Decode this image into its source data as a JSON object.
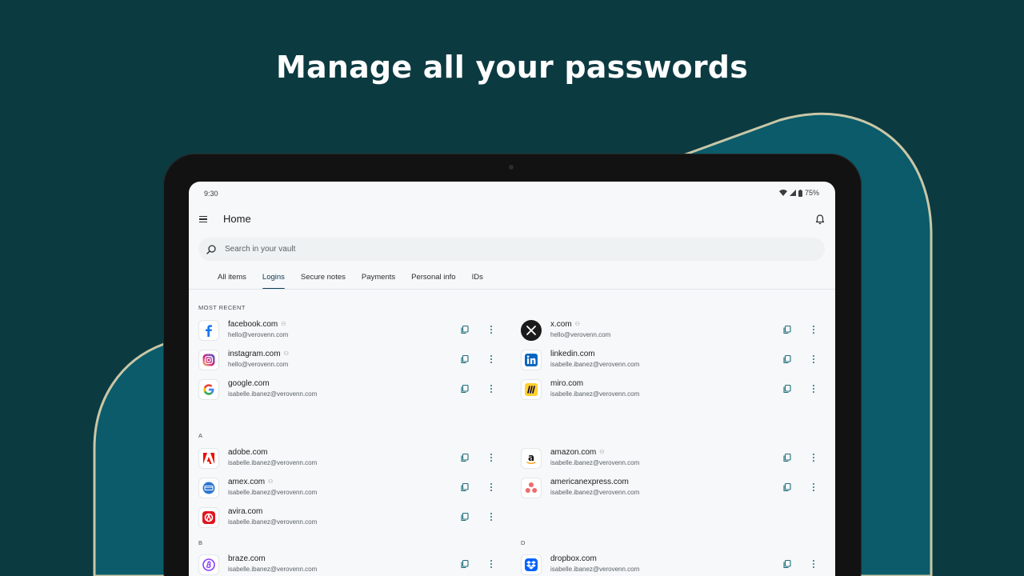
{
  "headline": "Manage all your passwords",
  "status_bar": {
    "time": "9:30",
    "battery": "75%"
  },
  "header": {
    "title": "Home"
  },
  "search": {
    "placeholder": "Search in your vault"
  },
  "tabs": [
    {
      "label": "All items",
      "active": false
    },
    {
      "label": "Logins",
      "active": true
    },
    {
      "label": "Secure notes",
      "active": false
    },
    {
      "label": "Payments",
      "active": false
    },
    {
      "label": "Personal info",
      "active": false
    },
    {
      "label": "IDs",
      "active": false
    }
  ],
  "sections": [
    {
      "label": "MOST RECENT"
    },
    {
      "label": "A"
    },
    {
      "label": "B"
    },
    {
      "label": "D"
    }
  ],
  "items": [
    {
      "site": "facebook.com",
      "user": "hello@verovenn.com",
      "shared": true,
      "icon": "facebook-icon"
    },
    {
      "site": "x.com",
      "user": "hello@verovenn.com",
      "shared": true,
      "icon": "x-icon"
    },
    {
      "site": "instagram.com",
      "user": "hello@verovenn.com",
      "shared": true,
      "icon": "instagram-icon"
    },
    {
      "site": "linkedin.com",
      "user": "isabelle.ibanez@verovenn.com",
      "shared": false,
      "icon": "linkedin-icon"
    },
    {
      "site": "google.com",
      "user": "isabelle.ibanez@verovenn.com",
      "shared": false,
      "icon": "google-icon"
    },
    {
      "site": "miro.com",
      "user": "isabelle.ibanez@verovenn.com",
      "shared": false,
      "icon": "miro-icon"
    },
    {
      "site": "adobe.com",
      "user": "isabelle.ibanez@verovenn.com",
      "shared": false,
      "icon": "adobe-icon"
    },
    {
      "site": "amazon.com",
      "user": "isabelle.ibanez@verovenn.com",
      "shared": true,
      "icon": "amazon-icon"
    },
    {
      "site": "amex.com",
      "user": "isabelle.ibanez@verovenn.com",
      "shared": true,
      "icon": "amex-icon"
    },
    {
      "site": "americanexpress.com",
      "user": "isabelle.ibanez@verovenn.com",
      "shared": false,
      "icon": "asana-style-icon"
    },
    {
      "site": "avira.com",
      "user": "isabelle.ibanez@verovenn.com",
      "shared": false,
      "icon": "avira-icon"
    },
    {
      "site": "braze.com",
      "user": "isabelle.ibanez@verovenn.com",
      "shared": false,
      "icon": "braze-icon"
    },
    {
      "site": "dropbox.com",
      "user": "isabelle.ibanez@verovenn.com",
      "shared": false,
      "icon": "dropbox-icon"
    }
  ],
  "colors": {
    "background": "#0c3a41",
    "accent_shape": "#0b5b6a",
    "shape_outline": "#c9c7a7",
    "active_tab": "#0c3f5c",
    "action_icon": "#1f6e7a"
  }
}
